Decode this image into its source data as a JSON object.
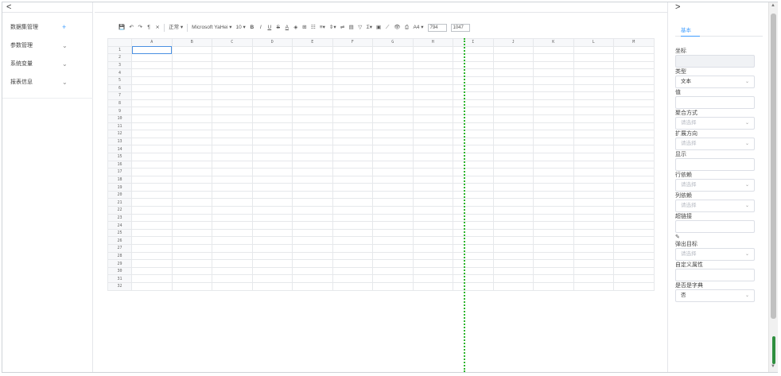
{
  "left": {
    "collapse": "<",
    "menu": [
      {
        "label": "数据集管理",
        "action": "+"
      },
      {
        "label": "参数管理",
        "action": "⌄"
      },
      {
        "label": "系统变量",
        "action": "⌄"
      },
      {
        "label": "报表信息",
        "action": "⌄"
      }
    ]
  },
  "toolbar": {
    "style": "正常 ▾",
    "font": "Microsoft YaHei ▾",
    "size": "10 ▾",
    "paper": "A4 ▾",
    "width": "794",
    "height": "1047"
  },
  "sheet": {
    "columns": [
      "A",
      "B",
      "C",
      "D",
      "E",
      "F",
      "G",
      "H",
      "I",
      "J",
      "K",
      "L",
      "M"
    ],
    "rows": [
      "1",
      "2",
      "3",
      "4",
      "5",
      "6",
      "7",
      "8",
      "9",
      "10",
      "11",
      "12",
      "13",
      "14",
      "15",
      "16",
      "17",
      "18",
      "19",
      "20",
      "21",
      "22",
      "23",
      "24",
      "25",
      "26",
      "27",
      "28",
      "29",
      "30",
      "31",
      "32"
    ]
  },
  "right": {
    "collapse": ">",
    "tab": "基本",
    "fields": {
      "coord": "坐标",
      "type": "类型",
      "type_value": "文本",
      "value": "值",
      "agg": "聚合方式",
      "agg_ph": "请选择",
      "expand": "扩展方向",
      "expand_ph": "请选择",
      "display": "显示",
      "row_dep": "行依赖",
      "row_dep_ph": "请选择",
      "col_dep": "列依赖",
      "col_dep_ph": "请选择",
      "link": "超链接",
      "popup": "弹出目标",
      "popup_ph": "请选择",
      "custom": "自定义属性",
      "is_dict": "是否是字典",
      "is_dict_value": "否"
    }
  }
}
